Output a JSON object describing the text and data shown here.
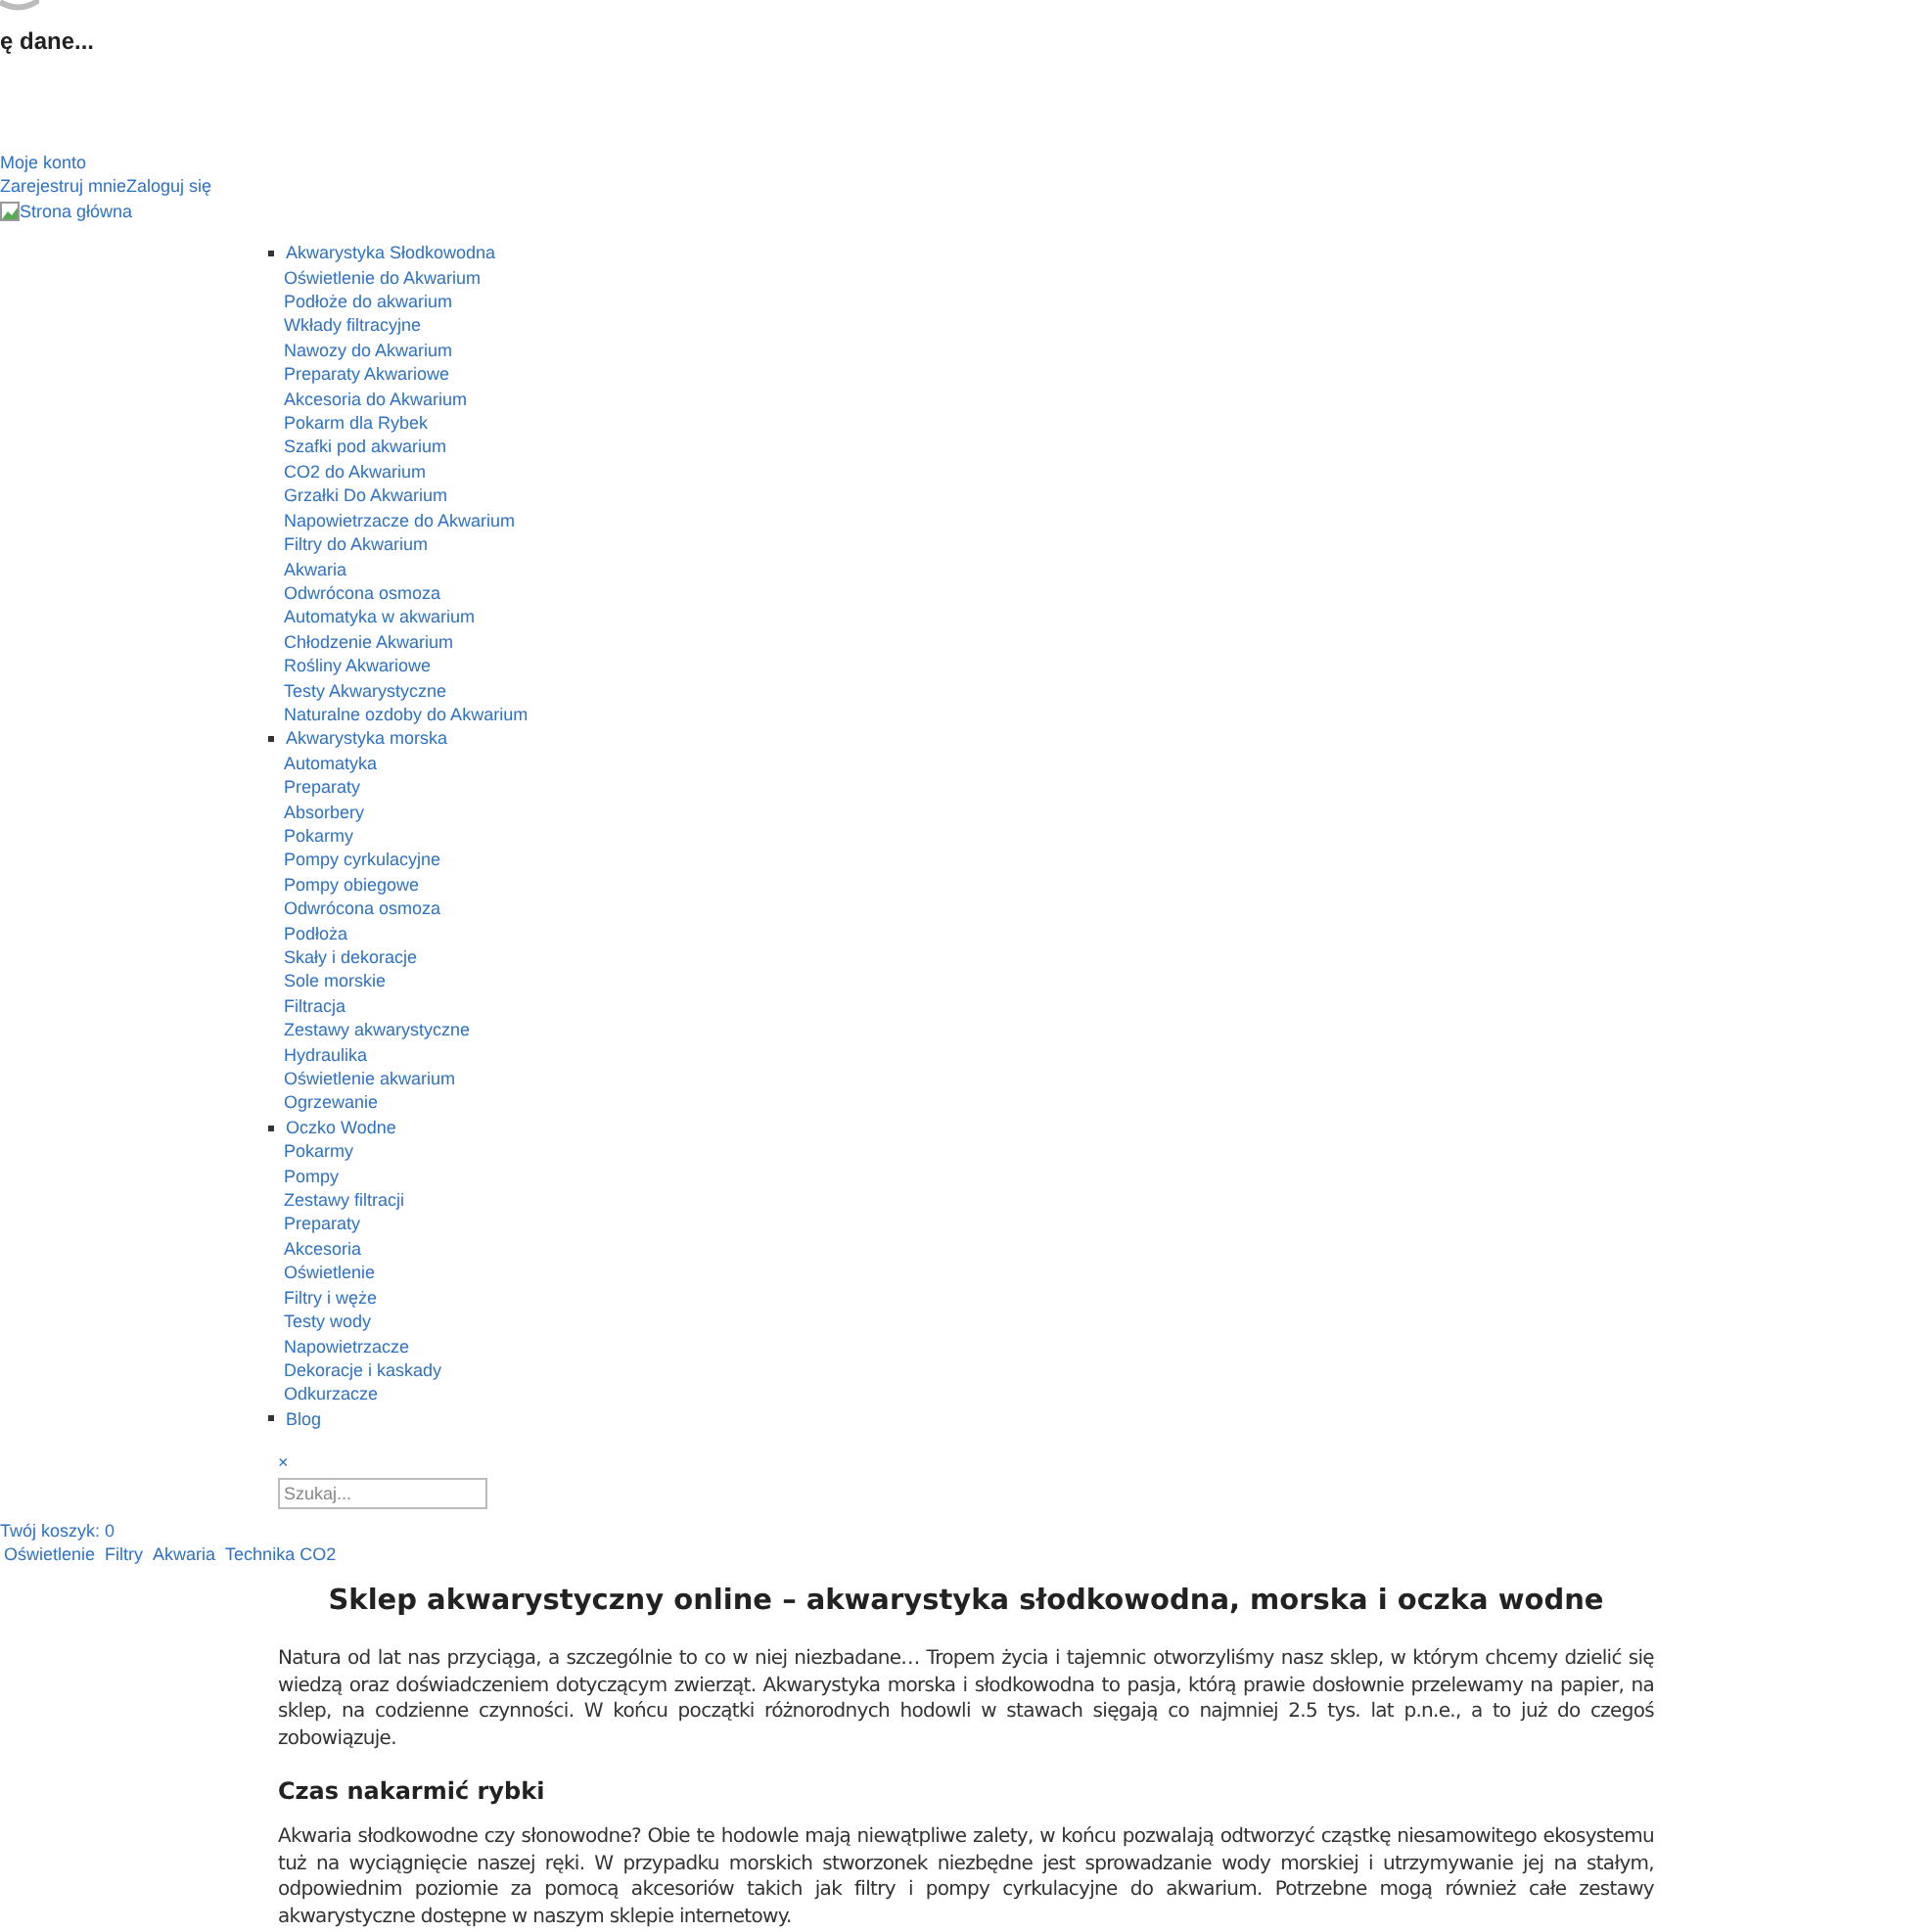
{
  "loading": {
    "text": "ę dane..."
  },
  "account": {
    "my_account": "Moje konto",
    "register": "Zarejestruj mnie",
    "login": "Zaloguj się",
    "home_image_alt": "Strona główna"
  },
  "menu": [
    {
      "label": "Akwarystyka Słodkowodna",
      "children": [
        {
          "label": "Oświetlenie do Akwarium"
        },
        {
          "label": "Podłoże do akwarium"
        },
        {
          "label": "Wkłady filtracyjne"
        },
        {
          "label": "Nawozy do Akwarium"
        },
        {
          "label": "Preparaty Akwariowe"
        },
        {
          "label": "Akcesoria do Akwarium"
        },
        {
          "label": "Pokarm dla Rybek"
        },
        {
          "label": "Szafki pod akwarium"
        },
        {
          "label": "CO2 do Akwarium"
        },
        {
          "label": "Grzałki Do Akwarium"
        },
        {
          "label": "Napowietrzacze do Akwarium"
        },
        {
          "label": "Filtry do Akwarium"
        },
        {
          "label": "Akwaria"
        },
        {
          "label": "Odwrócona osmoza"
        },
        {
          "label": "Automatyka w akwarium"
        },
        {
          "label": "Chłodzenie Akwarium"
        },
        {
          "label": "Rośliny Akwariowe"
        },
        {
          "label": "Testy Akwarystyczne"
        },
        {
          "label": "Naturalne ozdoby do Akwarium"
        }
      ]
    },
    {
      "label": "Akwarystyka morska",
      "children": [
        {
          "label": "Automatyka"
        },
        {
          "label": "Preparaty"
        },
        {
          "label": "Absorbery"
        },
        {
          "label": "Pokarmy"
        },
        {
          "label": "Pompy cyrkulacyjne"
        },
        {
          "label": "Pompy obiegowe"
        },
        {
          "label": "Odwrócona osmoza"
        },
        {
          "label": "Podłoża"
        },
        {
          "label": "Skały i dekoracje"
        },
        {
          "label": "Sole morskie"
        },
        {
          "label": "Filtracja"
        },
        {
          "label": "Zestawy akwarystyczne"
        },
        {
          "label": "Hydraulika"
        },
        {
          "label": "Oświetlenie akwarium"
        },
        {
          "label": "Ogrzewanie"
        }
      ]
    },
    {
      "label": "Oczko Wodne",
      "children": [
        {
          "label": "Pokarmy"
        },
        {
          "label": "Pompy"
        },
        {
          "label": "Zestawy filtracji"
        },
        {
          "label": "Preparaty"
        },
        {
          "label": "Akcesoria"
        },
        {
          "label": "Oświetlenie"
        },
        {
          "label": "Filtry i węże"
        },
        {
          "label": "Testy wody"
        },
        {
          "label": "Napowietrzacze"
        },
        {
          "label": "Dekoracje i kaskady"
        },
        {
          "label": "Odkurzacze"
        }
      ]
    },
    {
      "label": "Blog"
    }
  ],
  "search": {
    "close": "×",
    "placeholder": "Szukaj..."
  },
  "cart": {
    "text": "Twój koszyk: 0"
  },
  "tags": [
    "Oświetlenie",
    "Filtry",
    "Akwaria",
    "Technika CO2"
  ],
  "article": {
    "title": "Sklep akwarystyczny online – akwarystyka słodkowodna, morska i oczka wodne",
    "intro": "Natura od lat nas przyciąga, a szczególnie to co w niej niezbadane… Tropem życia i tajemnic otworzyliśmy nasz sklep, w którym chcemy dzielić się wiedzą oraz doświadczeniem dotyczącym zwierząt. Akwarystyka morska i słodkowodna to pasja, którą prawie dosłownie przelewamy na papier, na sklep, na codzienne czynności. W końcu początki różnorodnych hodowli w stawach sięgają co najmniej 2.5 tys. lat p.n.e., a to już do czegoś zobowiązuje.",
    "subheading": "Czas nakarmić rybki",
    "paragraph": "Akwaria słodkowodne czy słonowodne? Obie te hodowle mają niewątpliwe zalety, w końcu pozwalają odtworzyć cząstkę niesamowitego ekosystemu tuż na wyciągnięcie naszej ręki. W przypadku morskich stworzonek niezbędne jest sprowadzanie wody morskiej i utrzymywanie jej na stałym, odpowiednim poziomie za pomocą akcesoriów takich jak filtry i pompy cyrkulacyjne do akwarium. Potrzebne mogą również całe zestawy akwarystyczne dostępne w naszym sklepie internetowy."
  }
}
